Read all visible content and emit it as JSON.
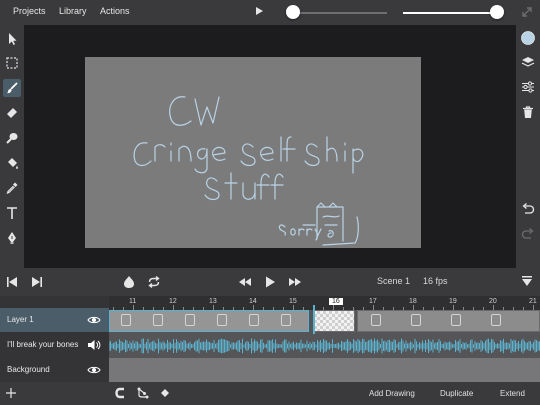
{
  "menu": {
    "projects": "Projects",
    "library": "Library",
    "actions": "Actions"
  },
  "topbar": {
    "onion_opacity": 0.12,
    "zoom": 1.0
  },
  "left_tools": [
    "pointer-icon",
    "marquee-select-icon",
    "brush-icon",
    "eraser-icon",
    "smudge-icon",
    "fill-bucket-icon",
    "eyedropper-icon",
    "text-icon",
    "pen-icon"
  ],
  "right_tools": [
    "color-swatch-icon",
    "layers-icon",
    "adjustments-icon",
    "trash-icon",
    "undo-icon",
    "redo-icon"
  ],
  "colors": {
    "accent": "#5ab2cf",
    "canvas": "#7b7b7b",
    "ink": "#b9d3e6",
    "panel": "#3a3a3c"
  },
  "playback": {
    "scene": "Scene 1",
    "fps": "16 fps"
  },
  "timeline": {
    "ticks": [
      "11",
      "12",
      "13",
      "14",
      "15",
      "16",
      "17",
      "18",
      "19",
      "20",
      "21"
    ],
    "current_frame": 16
  },
  "layers": [
    {
      "name": "Layer 1",
      "visible": true
    },
    {
      "name": "I'll break your bones",
      "type": "audio"
    },
    {
      "name": "Background",
      "visible": true
    }
  ],
  "bottom": {
    "add_drawing": "Add Drawing",
    "duplicate": "Duplicate",
    "extend": "Extend"
  }
}
